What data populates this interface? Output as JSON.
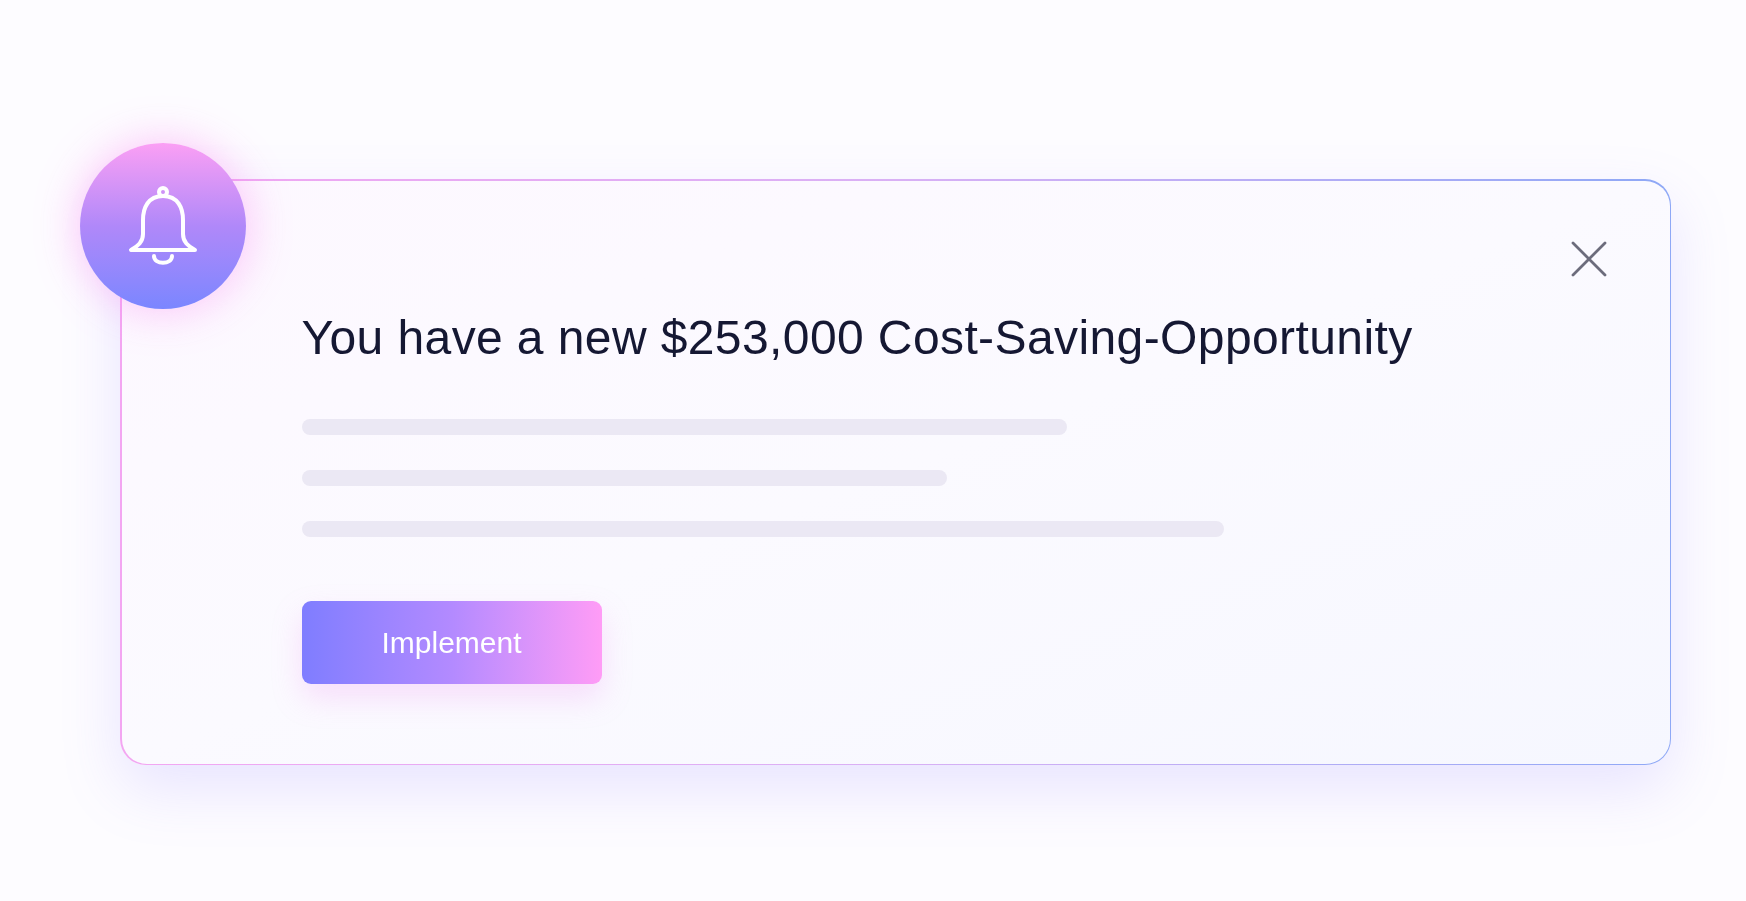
{
  "notification": {
    "title": "You have a new $253,000 Cost-Saving-Opportunity",
    "button": {
      "label": "Implement"
    }
  }
}
